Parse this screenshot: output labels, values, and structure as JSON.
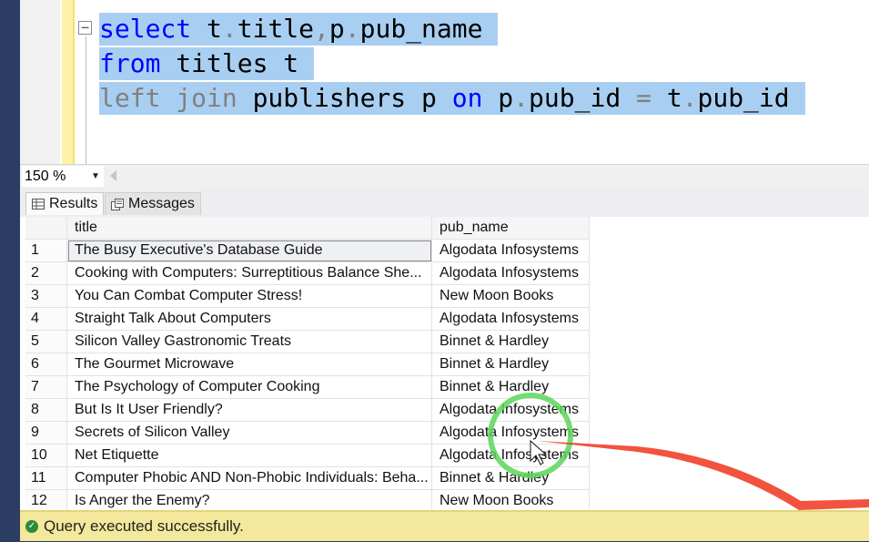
{
  "editor": {
    "fold_symbol": "−",
    "lines": [
      {
        "tokens": [
          {
            "text": "select",
            "style": "kw"
          },
          {
            "text": " t",
            "style": "plain"
          },
          {
            "text": ".",
            "style": "gray"
          },
          {
            "text": "title",
            "style": "plain"
          },
          {
            "text": ",",
            "style": "gray"
          },
          {
            "text": "p",
            "style": "plain"
          },
          {
            "text": ".",
            "style": "gray"
          },
          {
            "text": "pub_name ",
            "style": "plain"
          }
        ]
      },
      {
        "tokens": [
          {
            "text": "from",
            "style": "kw"
          },
          {
            "text": " titles t ",
            "style": "plain"
          }
        ]
      },
      {
        "tokens": [
          {
            "text": "left join",
            "style": "gray"
          },
          {
            "text": " publishers p ",
            "style": "plain"
          },
          {
            "text": "on",
            "style": "kw"
          },
          {
            "text": " p",
            "style": "plain"
          },
          {
            "text": ".",
            "style": "gray"
          },
          {
            "text": "pub_id ",
            "style": "plain"
          },
          {
            "text": "=",
            "style": "gray"
          },
          {
            "text": " t",
            "style": "plain"
          },
          {
            "text": ".",
            "style": "gray"
          },
          {
            "text": "pub_id ",
            "style": "plain"
          }
        ]
      }
    ]
  },
  "zoom": {
    "value": "150 %",
    "arrow": "▼"
  },
  "tabs": {
    "results_label": "Results",
    "messages_label": "Messages",
    "results_icon": "grid-icon",
    "messages_icon": "messages-icon"
  },
  "grid": {
    "columns": [
      "title",
      "pub_name"
    ],
    "rows": [
      {
        "n": "1",
        "title": "The Busy Executive's Database Guide",
        "pub": "Algodata Infosystems"
      },
      {
        "n": "2",
        "title": "Cooking with Computers: Surreptitious Balance She...",
        "pub": "Algodata Infosystems"
      },
      {
        "n": "3",
        "title": "You Can Combat Computer Stress!",
        "pub": "New Moon Books"
      },
      {
        "n": "4",
        "title": "Straight Talk About Computers",
        "pub": "Algodata Infosystems"
      },
      {
        "n": "5",
        "title": "Silicon Valley Gastronomic Treats",
        "pub": "Binnet & Hardley"
      },
      {
        "n": "6",
        "title": "The Gourmet Microwave",
        "pub": "Binnet & Hardley"
      },
      {
        "n": "7",
        "title": "The Psychology of Computer Cooking",
        "pub": "Binnet & Hardley"
      },
      {
        "n": "8",
        "title": "But Is It User Friendly?",
        "pub": "Algodata Infosystems"
      },
      {
        "n": "9",
        "title": "Secrets of Silicon Valley",
        "pub": "Algodata Infosystems"
      },
      {
        "n": "10",
        "title": "Net Etiquette",
        "pub": "Algodata Infosystems"
      },
      {
        "n": "11",
        "title": "Computer Phobic AND Non-Phobic Individuals: Beha...",
        "pub": "Binnet & Hardley"
      },
      {
        "n": "12",
        "title": "Is Anger the Enemy?",
        "pub": "New Moon Books"
      }
    ]
  },
  "status": {
    "text": "Query executed successfully.",
    "icon": "check-circle-icon",
    "icon_glyph": "✓"
  },
  "colors": {
    "selection": "#a8cff1",
    "keyword": "#0000ff",
    "status_bg": "#f3e89b",
    "annotation_circle": "#5ad65a",
    "annotation_arrow": "#f0402a"
  }
}
